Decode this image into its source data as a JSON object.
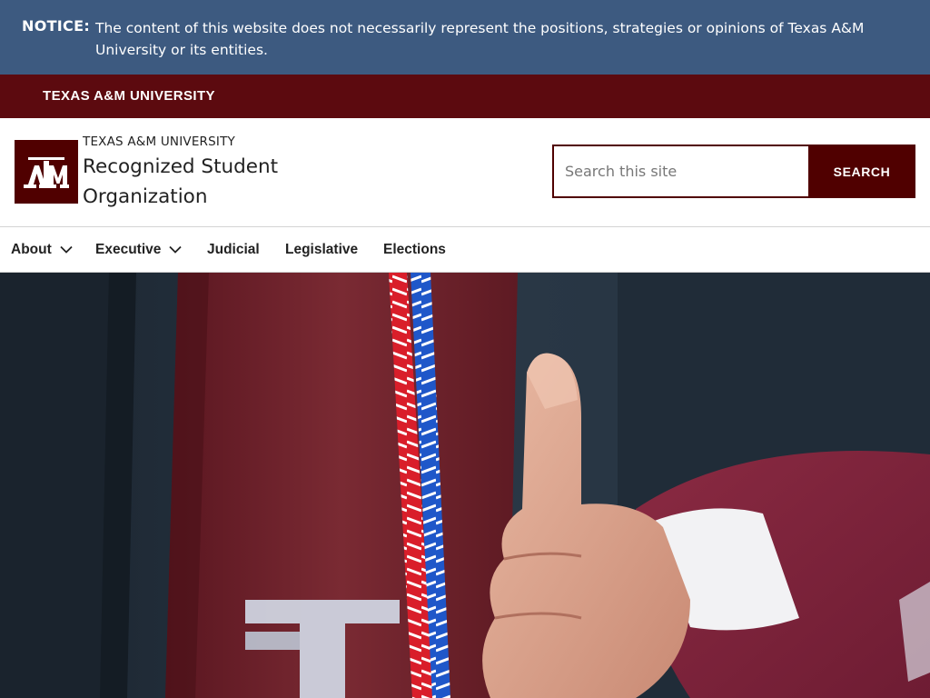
{
  "notice": {
    "label": "NOTICE:",
    "text": "The content of this website does not necessarily represent the positions, strategies or opinions of Texas A&M University or its entities."
  },
  "university_bar": {
    "link_label": "TEXAS A&M UNIVERSITY"
  },
  "header": {
    "logo_text": "ATM",
    "eyebrow": "TEXAS A&M UNIVERSITY",
    "site_title": "Recognized Student Organization"
  },
  "search": {
    "placeholder": "Search this site",
    "value": "",
    "button_label": "SEARCH"
  },
  "nav": {
    "items": [
      {
        "label": "About",
        "has_dropdown": true
      },
      {
        "label": "Executive",
        "has_dropdown": true
      },
      {
        "label": "Judicial",
        "has_dropdown": false
      },
      {
        "label": "Legislative",
        "has_dropdown": false
      },
      {
        "label": "Elections",
        "has_dropdown": false
      }
    ]
  },
  "hero": {
    "image_description_icon": "graduate-thumbs-up-photo",
    "stole_text": "ATM"
  },
  "colors": {
    "notice_bg": "#3d5a80",
    "maroon": "#500000",
    "maroon_bar": "#5c0a0f",
    "text_dark": "#222222"
  }
}
